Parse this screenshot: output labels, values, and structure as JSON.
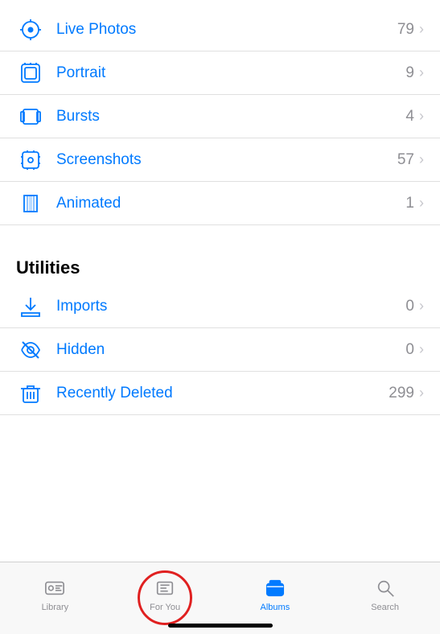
{
  "items": [
    {
      "id": "live-photos",
      "label": "Live Photos",
      "count": "79",
      "icon": "live-photos"
    },
    {
      "id": "portrait",
      "label": "Portrait",
      "count": "9",
      "icon": "portrait"
    },
    {
      "id": "bursts",
      "label": "Bursts",
      "count": "4",
      "icon": "bursts"
    },
    {
      "id": "screenshots",
      "label": "Screenshots",
      "count": "57",
      "icon": "screenshots"
    },
    {
      "id": "animated",
      "label": "Animated",
      "count": "1",
      "icon": "animated"
    }
  ],
  "utilities_header": "Utilities",
  "utilities": [
    {
      "id": "imports",
      "label": "Imports",
      "count": "0",
      "icon": "imports"
    },
    {
      "id": "hidden",
      "label": "Hidden",
      "count": "0",
      "icon": "hidden"
    },
    {
      "id": "recently-deleted",
      "label": "Recently Deleted",
      "count": "299",
      "icon": "trash"
    }
  ],
  "tabs": [
    {
      "id": "library",
      "label": "Library",
      "active": false
    },
    {
      "id": "for-you",
      "label": "For You",
      "active": false
    },
    {
      "id": "albums",
      "label": "Albums",
      "active": true
    },
    {
      "id": "search",
      "label": "Search",
      "active": false
    }
  ]
}
